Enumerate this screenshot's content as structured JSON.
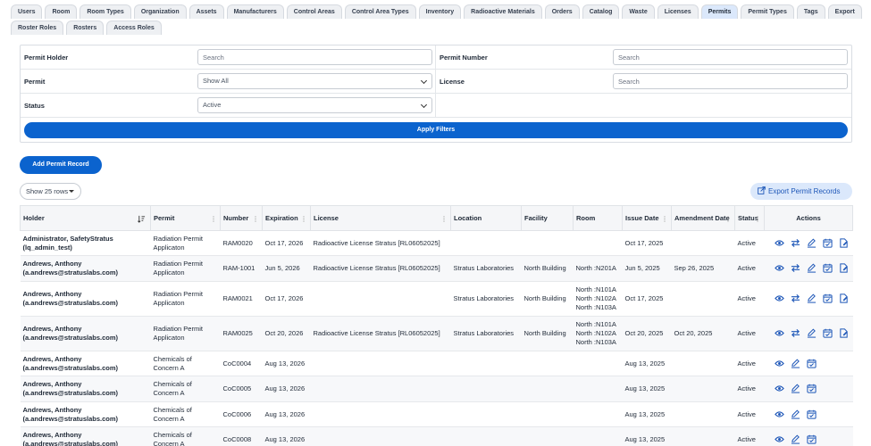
{
  "tabs_row1": [
    "Users",
    "Room",
    "Room Types",
    "Organization",
    "Assets",
    "Manufacturers",
    "Control Areas",
    "Control Area Types",
    "Inventory",
    "Radioactive Materials",
    "Orders",
    "Catalog",
    "Waste",
    "Licenses",
    "Permits",
    "Permit Types",
    "Tags",
    "Export"
  ],
  "tabs_row2": [
    "Roster Roles",
    "Rosters",
    "Access Roles"
  ],
  "active_tab": "Permits",
  "filters": {
    "permit_holder_label": "Permit Holder",
    "permit_holder_placeholder": "Search",
    "permit_number_label": "Permit Number",
    "permit_number_placeholder": "Search",
    "permit_label": "Permit",
    "permit_value": "Show All",
    "license_label": "License",
    "license_placeholder": "Search",
    "status_label": "Status",
    "status_value": "Active",
    "apply_label": "Apply Filters"
  },
  "add_button_label": "Add Permit Record",
  "show_rows_label": "Show 25 rows",
  "export_label": "Export Permit Records",
  "columns": [
    "Holder",
    "Permit",
    "Number",
    "Expiration",
    "License",
    "Location",
    "Facility",
    "Room",
    "Issue Date",
    "Amendment Date",
    "Status",
    "Actions"
  ],
  "rows": [
    {
      "holder": "Administrator, SafetyStratus (lq_admin_test)",
      "permit": "Radiation Permit Applicaton",
      "number": "RAM0020",
      "expiration": "Oct 17, 2026",
      "license": "Radioactive License Stratus [RL06052025]",
      "location": "",
      "facility": "",
      "room": "",
      "issue": "Oct 17, 2025",
      "amend": "",
      "status": "Active",
      "actions": [
        "eye",
        "swap",
        "edit",
        "calendar",
        "doc"
      ]
    },
    {
      "holder": "Andrews, Anthony (a.andrews@stratuslabs.com)",
      "permit": "Radiation Permit Applicaton",
      "number": "RAM-1001",
      "expiration": "Jun 5, 2026",
      "license": "Radioactive License Stratus [RL06052025]",
      "location": "Stratus Laboratories",
      "facility": "North Building",
      "room": "North :N201A",
      "issue": "Jun 5, 2025",
      "amend": "Sep 26, 2025",
      "status": "Active",
      "actions": [
        "eye",
        "swap",
        "edit",
        "calendar",
        "doc"
      ]
    },
    {
      "holder": "Andrews, Anthony (a.andrews@stratuslabs.com)",
      "permit": "Radiation Permit Applicaton",
      "number": "RAM0021",
      "expiration": "Oct 17, 2026",
      "license": "",
      "location": "Stratus Laboratories",
      "facility": "North Building",
      "room": "North :N101A North :N102A North :N103A",
      "issue": "Oct 17, 2025",
      "amend": "",
      "status": "Active",
      "actions": [
        "eye",
        "swap",
        "edit",
        "calendar",
        "doc"
      ]
    },
    {
      "holder": "Andrews, Anthony (a.andrews@stratuslabs.com)",
      "permit": "Radiation Permit Applicaton",
      "number": "RAM0025",
      "expiration": "Oct 20, 2026",
      "license": "Radioactive License Stratus [RL06052025]",
      "location": "Stratus Laboratories",
      "facility": "North Building",
      "room": "North :N101A North :N102A North :N103A",
      "issue": "Oct 20, 2025",
      "amend": "Oct 20, 2025",
      "status": "Active",
      "actions": [
        "eye",
        "swap",
        "edit",
        "calendar",
        "doc"
      ]
    },
    {
      "holder": "Andrews, Anthony (a.andrews@stratuslabs.com)",
      "permit": "Chemicals of Concern A",
      "number": "CoC0004",
      "expiration": "Aug 13, 2026",
      "license": "",
      "location": "",
      "facility": "",
      "room": "",
      "issue": "Aug 13, 2025",
      "amend": "",
      "status": "Active",
      "actions": [
        "eye",
        "edit",
        "calendar"
      ]
    },
    {
      "holder": "Andrews, Anthony (a.andrews@stratuslabs.com)",
      "permit": "Chemicals of Concern A",
      "number": "CoC0005",
      "expiration": "Aug 13, 2026",
      "license": "",
      "location": "",
      "facility": "",
      "room": "",
      "issue": "Aug 13, 2025",
      "amend": "",
      "status": "Active",
      "actions": [
        "eye",
        "edit",
        "calendar"
      ]
    },
    {
      "holder": "Andrews, Anthony (a.andrews@stratuslabs.com)",
      "permit": "Chemicals of Concern A",
      "number": "CoC0006",
      "expiration": "Aug 13, 2026",
      "license": "",
      "location": "",
      "facility": "",
      "room": "",
      "issue": "Aug 13, 2025",
      "amend": "",
      "status": "Active",
      "actions": [
        "eye",
        "edit",
        "calendar"
      ]
    },
    {
      "holder": "Andrews, Anthony (a.andrews@stratuslabs.com)",
      "permit": "Chemicals of Concern A",
      "number": "CoC0008",
      "expiration": "Aug 13, 2026",
      "license": "",
      "location": "",
      "facility": "",
      "room": "",
      "issue": "Aug 13, 2025",
      "amend": "",
      "status": "Active",
      "actions": [
        "eye",
        "edit",
        "calendar"
      ]
    }
  ],
  "colors": {
    "primary": "#0b63ce",
    "icon": "#1e57b8",
    "active_tab": "#dbe8fb"
  }
}
